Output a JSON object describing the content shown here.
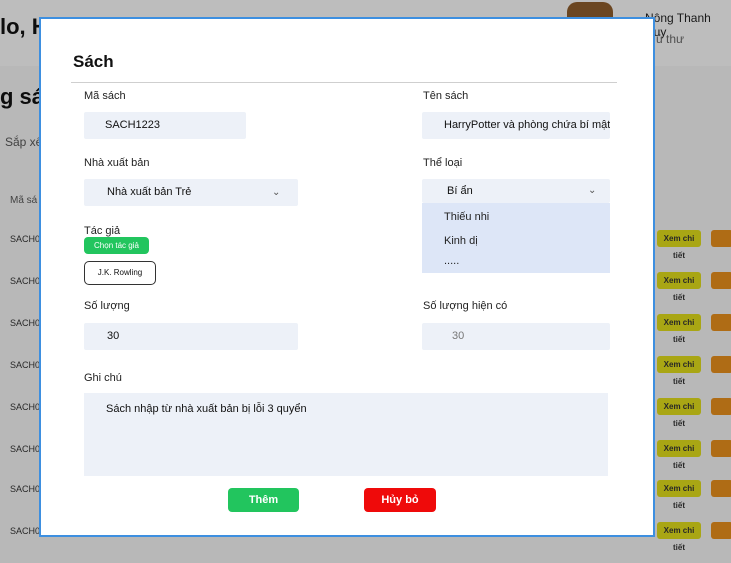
{
  "background": {
    "greeting": "lo, H",
    "user_name": "Nông Thanh Huy",
    "user_role": "ủ thư",
    "section_title": "g sá",
    "sort_label": "Sắp xế",
    "column_label": "Mã sá",
    "row_ids": [
      "SACH0",
      "SACH0",
      "SACH0",
      "SACH00",
      "SACH0",
      "SACH00",
      "SACH00",
      "SACH0"
    ],
    "detail_label": "Xem chi tiết"
  },
  "modal": {
    "title": "Sách",
    "book_id": {
      "label": "Mã sách",
      "value": "SACH1223"
    },
    "book_name": {
      "label": "Tên sách",
      "value": "HarryPotter và phòng chứa bí mật"
    },
    "publisher": {
      "label": "Nhà xuất bản",
      "value": "Nhà xuất bản Trẻ"
    },
    "genre": {
      "label": "Thể loại",
      "value": "Bí ẩn",
      "options": [
        "Thiếu nhi",
        "Kinh dị",
        "....."
      ]
    },
    "author": {
      "label": "Tác giả",
      "choose_button": "Chọn tác giả",
      "selected": "J.K. Rowling"
    },
    "quantity": {
      "label": "Số lượng",
      "value": "30"
    },
    "available": {
      "label": "Số lượng hiện có",
      "value": "30"
    },
    "note": {
      "label": "Ghi chú",
      "value": "Sách nhập từ nhà xuất bản bị lỗi 3 quyển"
    },
    "add_button": "Thêm",
    "cancel_button": "Hủy bỏ"
  },
  "colors": {
    "accent": "#3d8fe0",
    "green": "#22c55e",
    "red": "#ef0a0a",
    "field_bg": "#edf1f8"
  }
}
